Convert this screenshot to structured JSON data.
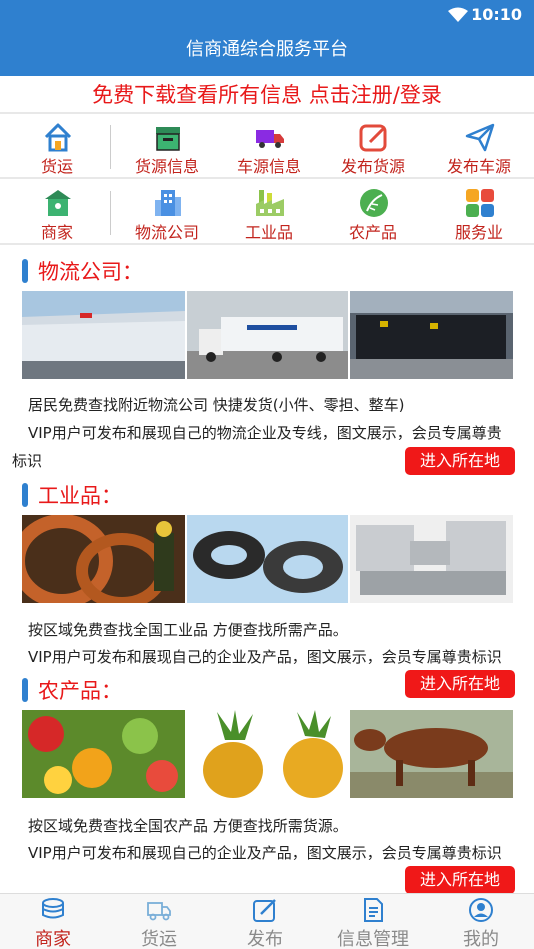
{
  "status": {
    "time": "10:10"
  },
  "app": {
    "title": "信商通综合服务平台"
  },
  "promo": {
    "text": "免费下载查看所有信息  点击注册/登录"
  },
  "categories_row1": [
    {
      "label": "货运",
      "icon": "house-icon"
    },
    {
      "label": "货源信息",
      "icon": "box-icon"
    },
    {
      "label": "车源信息",
      "icon": "truck-icon"
    },
    {
      "label": "发布货源",
      "icon": "edit-icon"
    },
    {
      "label": "发布车源",
      "icon": "send-icon"
    }
  ],
  "categories_row2": [
    {
      "label": "商家",
      "icon": "shop-icon"
    },
    {
      "label": "物流公司",
      "icon": "building-icon"
    },
    {
      "label": "工业品",
      "icon": "factory-icon"
    },
    {
      "label": "农产品",
      "icon": "leaf-icon"
    },
    {
      "label": "服务业",
      "icon": "grid-icon"
    }
  ],
  "sections": [
    {
      "title": "物流公司：",
      "line1": "居民免费查找附近物流公司 快捷发货(小件、零担、整车)",
      "line2a": "VIP用户可发布和展现自己的物流企业及专线，图文展示，会员专属尊贵",
      "line2b": "标识",
      "button": "进入所在地"
    },
    {
      "title": "工业品：",
      "line1": "按区域免费查找全国工业品 方便查找所需产品。",
      "line2a": "VIP用户可发布和展现自己的企业及产品，图文展示，会员专属尊贵标识",
      "button": "进入所在地"
    },
    {
      "title": "农产品：",
      "line1": "按区域免费查找全国农产品 方便查找所需货源。",
      "line2a": "VIP用户可发布和展现自己的企业及产品，图文展示，会员专属尊贵标识",
      "button": "进入所在地"
    }
  ],
  "tabs": [
    {
      "label": "商家",
      "icon": "coins-icon",
      "active": true
    },
    {
      "label": "货运",
      "icon": "delivery-icon",
      "active": false
    },
    {
      "label": "发布",
      "icon": "edit-icon",
      "active": false
    },
    {
      "label": "信息管理",
      "icon": "document-icon",
      "active": false
    },
    {
      "label": "我的",
      "icon": "profile-icon",
      "active": false
    }
  ],
  "colors": {
    "brand_blue": "#2f80cf",
    "accent_red": "#e8191a",
    "label_red": "#c2241d"
  }
}
